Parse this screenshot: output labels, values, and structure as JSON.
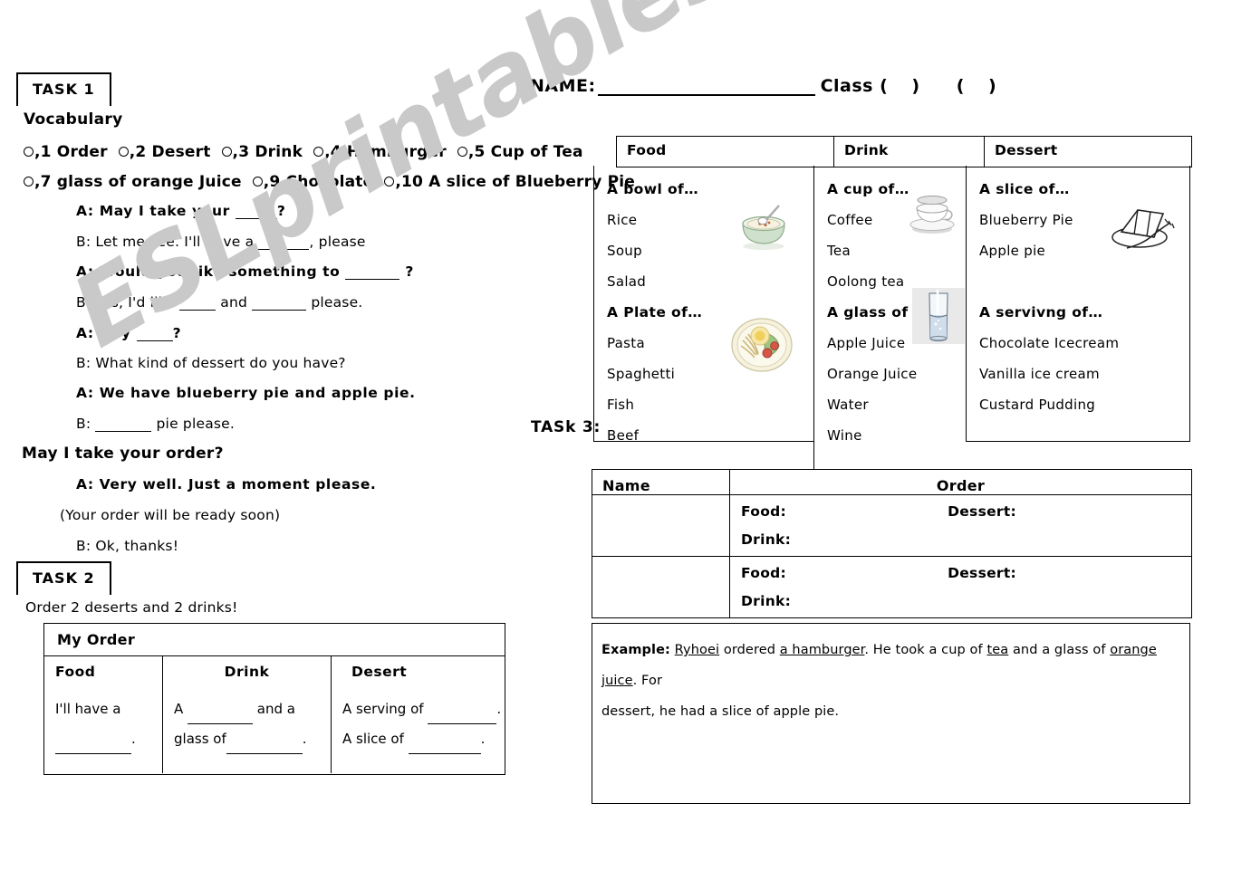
{
  "header": {
    "name_label": "NAME:",
    "class_label": "Class",
    "paren_open": "(",
    "paren_close": ")"
  },
  "task1": {
    "badge": "TASK 1",
    "vocabulary_title": "Vocabulary",
    "vocab_row1": [
      {
        "num": ",1",
        "label": "Order"
      },
      {
        "num": ",2",
        "label": "Desert"
      },
      {
        "num": ",3",
        "label": "Drink"
      },
      {
        "num": ",4",
        "label": "Hamburger"
      },
      {
        "num": ",5",
        "label": "Cup of Tea"
      }
    ],
    "vocab_row2": [
      {
        "num": ",7",
        "label": "glass of orange Juice"
      },
      {
        "num": ",9",
        "label": "Chocolate"
      },
      {
        "num": ",10",
        "label": "A slice of Blueberry Pie"
      }
    ],
    "dialogue": [
      {
        "speaker": "A:",
        "bold": true,
        "pre": "May I take your ",
        "blank": 46,
        "post": "?"
      },
      {
        "speaker": "B:",
        "bold": false,
        "pre": "Let me see. I'll have a ",
        "blank": 56,
        "post": ", please"
      },
      {
        "speaker": "A:",
        "bold": true,
        "pre": "Would you like something to ",
        "blank": 60,
        "post": " ?"
      },
      {
        "speaker": "B:",
        "bold": false,
        "pre": "Yes, I'd like ",
        "blank": 40,
        "mid": " and ",
        "blank2": 60,
        "post": " please."
      },
      {
        "speaker": "A:",
        "bold": true,
        "pre": "Any ",
        "blank": 40,
        "post": "?"
      },
      {
        "speaker": "B:",
        "bold": false,
        "pre": "What kind of dessert do you have?",
        "blank": 0,
        "post": ""
      },
      {
        "speaker": "A:",
        "bold": true,
        "pre": "We have blueberry pie and apple pie.",
        "blank": 0,
        "post": ""
      },
      {
        "speaker": "B:",
        "bold": false,
        "pre": "",
        "blank": 62,
        "post": " pie please."
      }
    ],
    "headline": "May I take your order?",
    "closing": [
      {
        "speaker": "A:",
        "bold": true,
        "text": "Very well. Just a moment please."
      },
      {
        "speaker": "",
        "bold": false,
        "text": "(Your order will be ready soon)"
      },
      {
        "speaker": "B:",
        "bold": false,
        "text": "Ok, thanks!"
      }
    ]
  },
  "task2": {
    "badge": "TASK 2",
    "instruction": "Order 2 deserts and 2 drinks!",
    "table_title": "My Order",
    "columns": [
      "Food",
      "Drink",
      "Desert"
    ],
    "food_lines": [
      {
        "pre": "I'll have a",
        "blank": 0,
        "post": ""
      },
      {
        "pre": "",
        "blank": 84,
        "post": "."
      }
    ],
    "drink_lines": [
      {
        "pre": "A ",
        "blank": 72,
        "post": " and a"
      },
      {
        "pre": "glass of",
        "blank": 84,
        "post": "."
      }
    ],
    "desert_lines": [
      {
        "pre": "A serving of ",
        "blank": 76,
        "post": "."
      },
      {
        "pre": "A slice of ",
        "blank": 80,
        "post": "."
      }
    ]
  },
  "task3": {
    "label": "TASk 3:",
    "menu_headers": [
      "Food",
      "Drink",
      "Dessert"
    ],
    "food_column": [
      {
        "type": "group",
        "text": "A bowl of…"
      },
      {
        "type": "item",
        "text": "Rice"
      },
      {
        "type": "item",
        "text": "Soup"
      },
      {
        "type": "item",
        "text": "Salad"
      },
      {
        "type": "group",
        "text": "A Plate of…"
      },
      {
        "type": "item",
        "text": "Pasta"
      },
      {
        "type": "item",
        "text": "Spaghetti"
      },
      {
        "type": "item",
        "text": "Fish"
      },
      {
        "type": "item",
        "text": "Beef"
      }
    ],
    "drink_column": [
      {
        "type": "group",
        "text": "A cup of…"
      },
      {
        "type": "item",
        "text": "Coffee"
      },
      {
        "type": "item",
        "text": "Tea"
      },
      {
        "type": "item",
        "text": "Oolong tea"
      },
      {
        "type": "group",
        "text": "A glass of"
      },
      {
        "type": "item",
        "text": "Apple Juice"
      },
      {
        "type": "item",
        "text": "Orange Juice"
      },
      {
        "type": "item",
        "text": "Water"
      },
      {
        "type": "item",
        "text": "Wine"
      }
    ],
    "dessert_column": [
      {
        "type": "group",
        "text": "A slice of…"
      },
      {
        "type": "item",
        "text": "Blueberry Pie"
      },
      {
        "type": "item",
        "text": "Apple pie"
      },
      {
        "type": "blank",
        "text": ""
      },
      {
        "type": "group",
        "text": "A servivng of…"
      },
      {
        "type": "item",
        "text": "Chocolate Icecream"
      },
      {
        "type": "item",
        "text": "Vanilla ice cream"
      },
      {
        "type": "item",
        "text": "Custard Pudding"
      }
    ],
    "order_table": {
      "header_name": "Name",
      "header_order": "Order",
      "rows": [
        {
          "food": "Food:",
          "dessert": "Dessert:",
          "drink": "Drink:"
        },
        {
          "food": "Food:",
          "dessert": "Dessert:",
          "drink": "Drink:"
        }
      ]
    },
    "example": {
      "label": "Example:",
      "line1_a": " ",
      "name": "Ryhoei",
      "line1_b": " ordered ",
      "item": "a hamburger",
      "line1_c": ". He took a cup of ",
      "drink1": "tea",
      "line1_d": " and a glass of ",
      "drink2": "orange juice",
      "line1_e": ". For",
      "line2": "dessert, he had a slice of apple pie."
    }
  },
  "watermark": {
    "text": "ESLprintables.com"
  },
  "icons": {
    "bowl": "soup-bowl-icon",
    "plate": "pasta-plate-icon",
    "cup": "tea-cup-icon",
    "glass": "water-glass-icon",
    "pie": "pie-slice-icon"
  },
  "colors": {
    "line": "#000000",
    "watermark": "#c9c9c9",
    "bowl_green": "#cfe0cc",
    "plate_cream": "#f4efd8"
  }
}
